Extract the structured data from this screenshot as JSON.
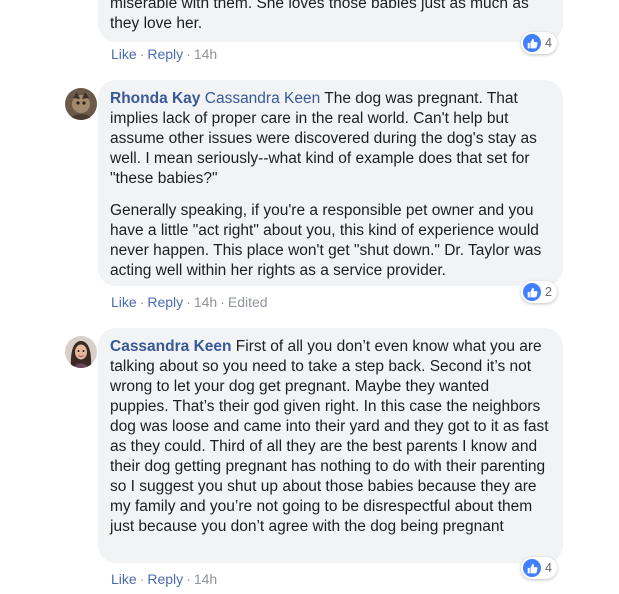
{
  "comments": [
    {
      "text_lines_partial": [
        "miserable with them. She loves those babies just as much as",
        "they love her."
      ],
      "actions": {
        "like": "Like",
        "reply": "Reply",
        "time": "14h"
      },
      "reaction_count": "4"
    },
    {
      "author": "Rhonda Kay",
      "mention": "Cassandra Keen",
      "paragraph1": "The dog was pregnant. That implies lack of proper care in the real world. Can't help but assume other issues were discovered during the dog's stay as well. I mean seriously--what kind of example does that set for \"these babies?\"",
      "paragraph2": "Generally speaking, if you're a responsible pet owner and you have a little \"act right\" about you, this kind of experience would never happen. This place won't get \"shut down.\" Dr. Taylor was acting well within her rights as a service provider.",
      "actions": {
        "like": "Like",
        "reply": "Reply",
        "time": "14h",
        "edited": "Edited"
      },
      "reaction_count": "2"
    },
    {
      "author": "Cassandra Keen",
      "text": "First of all you don’t even know what you are talking about so you need to take a step back. Second it’s not wrong to let your dog get pregnant. Maybe they wanted puppies. That’s their god given right. In this case the neighbors dog was loose and came into their yard and they got to it as fast as they could. Third of all they are the best parents I know and their dog getting pregnant has nothing to do with their parenting so I suggest you shut up about those babies because they are my family and you’re not going to be disrespectful about them just because you don’t agree with the dog being pregnant",
      "actions": {
        "like": "Like",
        "reply": "Reply",
        "time": "14h"
      },
      "reaction_count": "4"
    }
  ],
  "icons": {
    "reaction": "like-thumb-icon",
    "separator": "·"
  },
  "colors": {
    "link": "#385898",
    "bubble": "#f2f3f5",
    "like_badge": "#4080ff",
    "meta": "#90949c"
  }
}
